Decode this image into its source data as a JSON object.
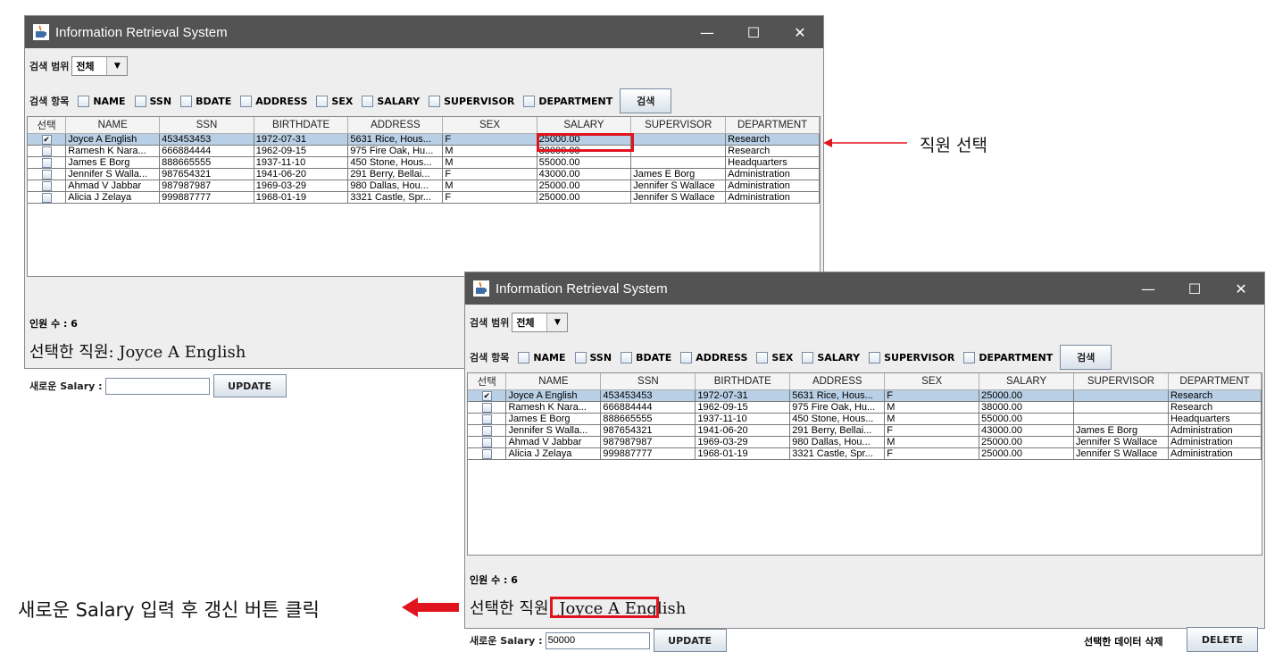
{
  "window_title": "Information Retrieval System",
  "controls": {
    "minimize": "—",
    "maximize": "☐",
    "close": "✕"
  },
  "scope_label": "검색 범위",
  "scope_value": "전체",
  "fields_label": "검색 항목",
  "fields": [
    "NAME",
    "SSN",
    "BDATE",
    "ADDRESS",
    "SEX",
    "SALARY",
    "SUPERVISOR",
    "DEPARTMENT"
  ],
  "search_button": "검색",
  "columns": [
    "선택",
    "NAME",
    "SSN",
    "BIRTHDATE",
    "ADDRESS",
    "SEX",
    "SALARY",
    "SUPERVISOR",
    "DEPARTMENT"
  ],
  "rows": [
    {
      "checked": true,
      "name": "Joyce A English",
      "ssn": "453453453",
      "bdate": "1972-07-31",
      "address": "5631 Rice, Hous...",
      "sex": "F",
      "salary": "25000.00",
      "supervisor": "",
      "department": "Research"
    },
    {
      "checked": false,
      "name": "Ramesh K Nara...",
      "ssn": "666884444",
      "bdate": "1962-09-15",
      "address": "975 Fire Oak, Hu...",
      "sex": "M",
      "salary": "38000.00",
      "supervisor": "",
      "department": "Research"
    },
    {
      "checked": false,
      "name": "James E Borg",
      "ssn": "888665555",
      "bdate": "1937-11-10",
      "address": "450 Stone, Hous...",
      "sex": "M",
      "salary": "55000.00",
      "supervisor": "",
      "department": "Headquarters"
    },
    {
      "checked": false,
      "name": "Jennifer S Walla...",
      "ssn": "987654321",
      "bdate": "1941-06-20",
      "address": "291 Berry, Bellai...",
      "sex": "F",
      "salary": "43000.00",
      "supervisor": "James E Borg",
      "department": "Administration"
    },
    {
      "checked": false,
      "name": "Ahmad V Jabbar",
      "ssn": "987987987",
      "bdate": "1969-03-29",
      "address": "980 Dallas, Hou...",
      "sex": "M",
      "salary": "25000.00",
      "supervisor": "Jennifer S Wallace",
      "department": "Administration"
    },
    {
      "checked": false,
      "name": "Alicia J Zelaya",
      "ssn": "999887777",
      "bdate": "1968-01-19",
      "address": "3321 Castle, Spr...",
      "sex": "F",
      "salary": "25000.00",
      "supervisor": "Jennifer S Wallace",
      "department": "Administration"
    }
  ],
  "employee_count": "인원 수 : 6",
  "selected_employee": "선택한 직원: Joyce A English",
  "salary_label": "새로운 Salary :",
  "window1": {
    "salary_value": ""
  },
  "window2": {
    "salary_value": "50000"
  },
  "update_button": "UPDATE",
  "delete_label": "선택한 데이터 삭제",
  "delete_button": "DELETE",
  "annotations": {
    "select_employee": "직원 선택",
    "enter_salary": "새로운 Salary 입력 후 갱신 버튼 클릭"
  },
  "colors": {
    "titlebar": "#535353",
    "window_bg": "#eeeeee",
    "selection": "#b8cfe5",
    "highlight": "#e0141e"
  }
}
